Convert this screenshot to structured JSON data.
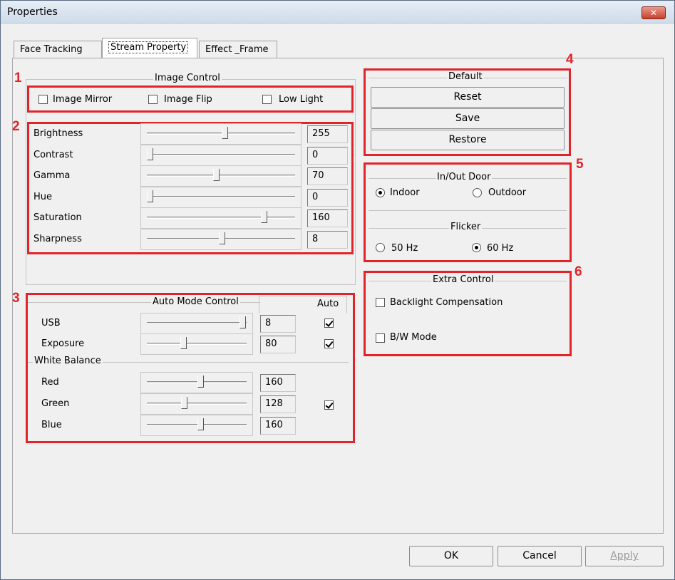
{
  "window": {
    "title": "Properties",
    "close_label": "✕"
  },
  "tabs": [
    {
      "label": "Face Tracking",
      "active": false
    },
    {
      "label": "Stream Property",
      "active": true
    },
    {
      "label": "Effect _Frame",
      "active": false
    }
  ],
  "image_control": {
    "title": "Image Control",
    "checkboxes": [
      {
        "label": "Image Mirror",
        "checked": false
      },
      {
        "label": "Image Flip",
        "checked": false
      },
      {
        "label": "Low Light",
        "checked": false
      }
    ],
    "sliders": [
      {
        "label": "Brightness",
        "value": "255",
        "level": 0.52
      },
      {
        "label": "Contrast",
        "value": "0",
        "level": 0.0
      },
      {
        "label": "Gamma",
        "value": "70",
        "level": 0.46
      },
      {
        "label": "Hue",
        "value": "0",
        "level": 0.0
      },
      {
        "label": "Saturation",
        "value": "160",
        "level": 0.79
      },
      {
        "label": "Sharpness",
        "value": "8",
        "level": 0.5
      }
    ]
  },
  "auto_mode": {
    "title": "Auto Mode Control",
    "auto_header": "Auto",
    "rows": [
      {
        "label": "USB",
        "value": "8",
        "level": 0.97,
        "auto": true
      },
      {
        "label": "Exposure",
        "value": "80",
        "level": 0.35,
        "auto": true
      }
    ],
    "white_balance_title": "White Balance",
    "wb_rows": [
      {
        "label": "Red",
        "value": "160",
        "level": 0.53
      },
      {
        "label": "Green",
        "value": "128",
        "level": 0.36
      },
      {
        "label": "Blue",
        "value": "160",
        "level": 0.53
      }
    ],
    "wb_auto": true
  },
  "default_group": {
    "title": "Default",
    "buttons": [
      "Reset",
      "Save",
      "Restore"
    ]
  },
  "in_out_door": {
    "title": "In/Out Door",
    "options": [
      {
        "label": "Indoor",
        "selected": true
      },
      {
        "label": "Outdoor",
        "selected": false
      }
    ],
    "flicker_title": "Flicker",
    "flicker_options": [
      {
        "label": "50 Hz",
        "selected": false
      },
      {
        "label": "60 Hz",
        "selected": true
      }
    ]
  },
  "extra_control": {
    "title": "Extra Control",
    "checkboxes": [
      {
        "label": "Backlight Compensation",
        "checked": false
      },
      {
        "label": "B/W Mode",
        "checked": false
      }
    ]
  },
  "annotations": [
    "1",
    "2",
    "3",
    "4",
    "5",
    "6"
  ],
  "footer": {
    "ok": "OK",
    "cancel": "Cancel",
    "apply": "Apply"
  },
  "colors": {
    "annotation_red": "#e0242a"
  }
}
